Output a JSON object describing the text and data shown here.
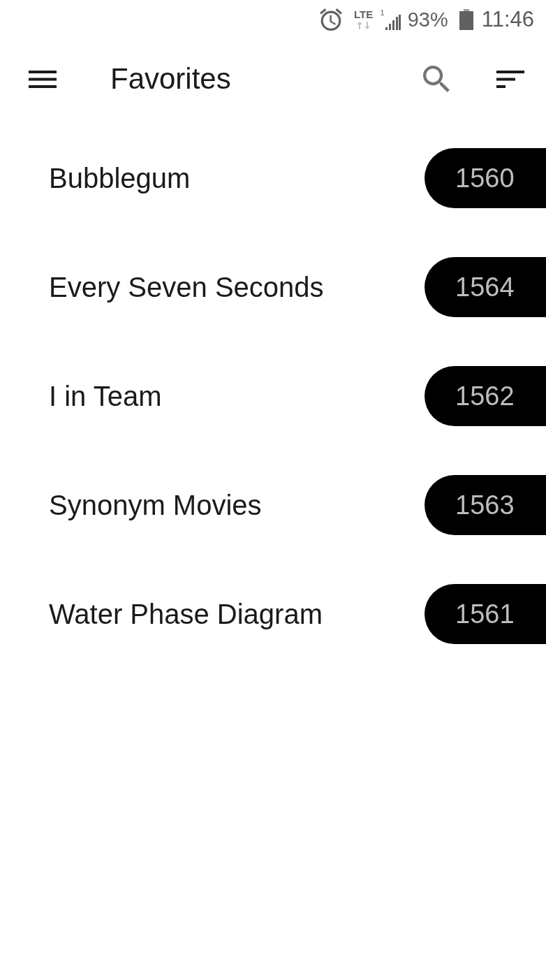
{
  "status_bar": {
    "network": "LTE",
    "sim_slot": "1",
    "battery": "93%",
    "time": "11:46"
  },
  "app_bar": {
    "title": "Favorites"
  },
  "items": [
    {
      "name": "Bubblegum",
      "count": "1560"
    },
    {
      "name": "Every Seven Seconds",
      "count": "1564"
    },
    {
      "name": "I in Team",
      "count": "1562"
    },
    {
      "name": "Synonym Movies",
      "count": "1563"
    },
    {
      "name": "Water Phase Diagram",
      "count": "1561"
    }
  ]
}
